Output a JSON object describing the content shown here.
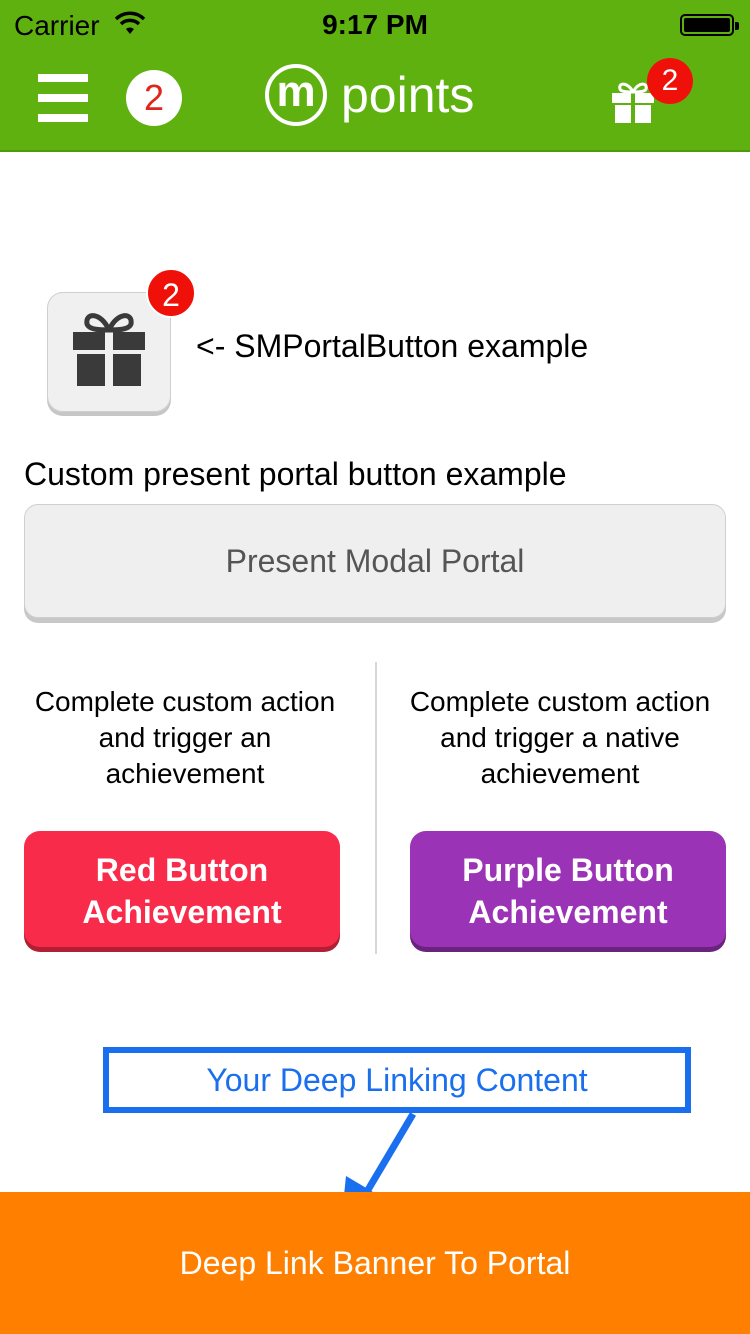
{
  "status_bar": {
    "carrier": "Carrier",
    "time": "9:17 PM"
  },
  "header": {
    "notification_count": "2",
    "logo_letter": "m",
    "logo_text": "points",
    "gift_badge": "2",
    "bg_color": "#5fb110"
  },
  "portal_button": {
    "badge": "2",
    "caption": "<- SMPortalButton example"
  },
  "custom_portal": {
    "label": "Custom present portal button example",
    "button_label": "Present Modal Portal"
  },
  "achievements": {
    "left_description": "Complete custom action and trigger an achievement",
    "right_description": "Complete custom action and trigger a native achievement",
    "red_button_label": "Red Button Achievement",
    "purple_button_label": "Purple Button Achievement",
    "red_color": "#f92b4b",
    "purple_color": "#9b33b7"
  },
  "deep_link": {
    "content_label": "Your Deep Linking Content",
    "banner_label": "Deep Link Banner To Portal",
    "banner_color": "#ff8000",
    "accent_color": "#1a6fef"
  }
}
